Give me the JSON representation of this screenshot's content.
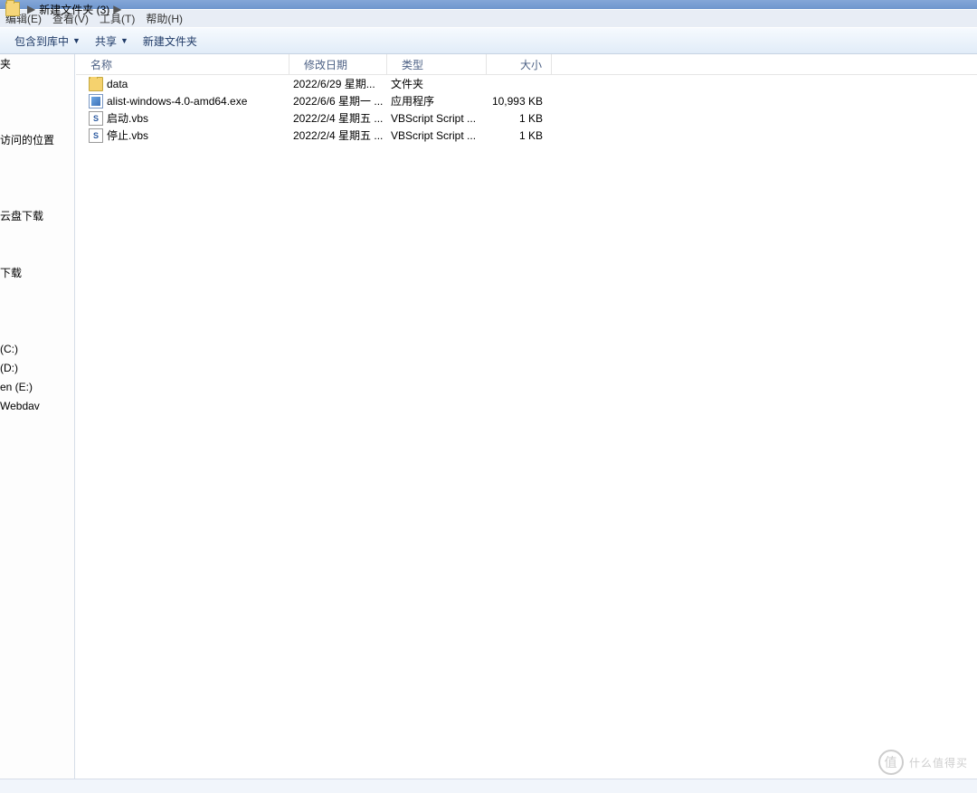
{
  "title": "新建文件夹 (3)",
  "breadcrumb": {
    "label": "新建文件夹 (3)"
  },
  "menubar": [
    {
      "id": "edit",
      "label": "编辑(E)"
    },
    {
      "id": "view",
      "label": "查看(V)"
    },
    {
      "id": "tools",
      "label": "工具(T)"
    },
    {
      "id": "help",
      "label": "帮助(H)"
    }
  ],
  "toolbar": [
    {
      "id": "include",
      "label": "包含到库中",
      "dropdown": true
    },
    {
      "id": "share",
      "label": "共享",
      "dropdown": true
    },
    {
      "id": "newfolder",
      "label": "新建文件夹",
      "dropdown": false
    }
  ],
  "columns": {
    "name": "名称",
    "date": "修改日期",
    "type": "类型",
    "size": "大小"
  },
  "sidebar": {
    "items": [
      {
        "label": "夹"
      },
      {
        "label": ""
      },
      {
        "label": ""
      },
      {
        "label": ""
      },
      {
        "label": "访问的位置"
      },
      {
        "label": "",
        "spacer": true
      },
      {
        "label": "",
        "spacer": true
      },
      {
        "label": ""
      },
      {
        "label": "云盘下载"
      },
      {
        "label": ""
      },
      {
        "label": ""
      },
      {
        "label": "下载"
      },
      {
        "label": ""
      },
      {
        "label": ""
      },
      {
        "label": ""
      },
      {
        "label": "(C:)"
      },
      {
        "label": "(D:)"
      },
      {
        "label": "en (E:)"
      },
      {
        "label": "Webdav"
      }
    ]
  },
  "files": [
    {
      "icon": "folder",
      "name": "data",
      "date": "2022/6/29 星期...",
      "type": "文件夹",
      "size": ""
    },
    {
      "icon": "exe",
      "name": "alist-windows-4.0-amd64.exe",
      "date": "2022/6/6 星期一 ...",
      "type": "应用程序",
      "size": "10,993 KB"
    },
    {
      "icon": "vbs",
      "name": "启动.vbs",
      "date": "2022/2/4 星期五 ...",
      "type": "VBScript Script ...",
      "size": "1 KB"
    },
    {
      "icon": "vbs",
      "name": "停止.vbs",
      "date": "2022/2/4 星期五 ...",
      "type": "VBScript Script ...",
      "size": "1 KB"
    }
  ],
  "watermark": {
    "text": "什么值得买",
    "icon": "值"
  }
}
